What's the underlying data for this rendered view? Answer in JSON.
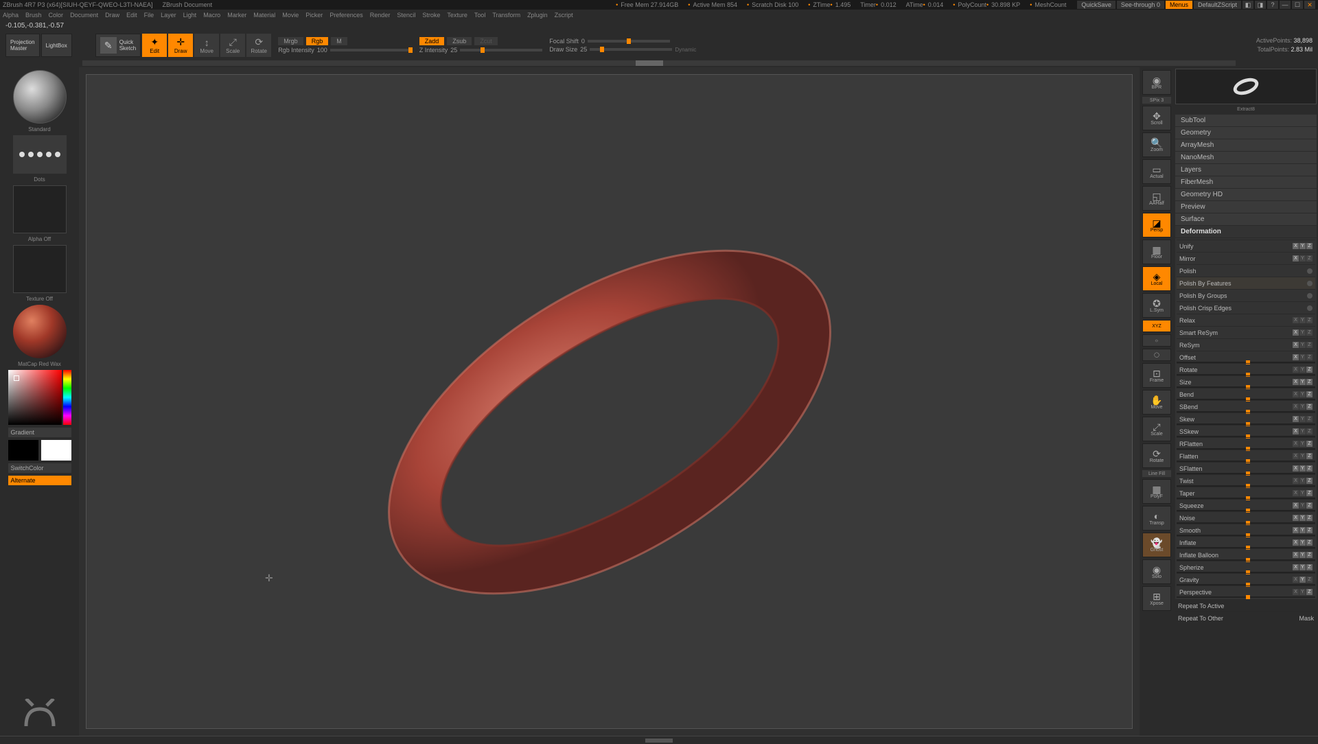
{
  "title": {
    "app": "ZBrush 4R7 P3 (x64)[SIUH-QEYF-QWEO-L3TI-NAEA]",
    "doc": "ZBrush Document",
    "free_mem_lbl": "Free Mem",
    "free_mem": "27.914GB",
    "active_mem_lbl": "Active Mem",
    "active_mem": "854",
    "scratch_lbl": "Scratch Disk",
    "scratch": "100",
    "ztime_lbl": "ZTime",
    "ztime": "1.495",
    "timer_lbl": "Timer",
    "timer": "0.012",
    "atime_lbl": "ATime",
    "atime": "0.014",
    "poly_lbl": "PolyCount",
    "poly": "30.898 KP",
    "mesh_lbl": "MeshCount",
    "quicksave": "QuickSave",
    "seethrough": "See-through  0",
    "menus": "Menus",
    "script": "DefaultZScript"
  },
  "menus": [
    "Alpha",
    "Brush",
    "Color",
    "Document",
    "Draw",
    "Edit",
    "File",
    "Layer",
    "Light",
    "Macro",
    "Marker",
    "Material",
    "Movie",
    "Picker",
    "Preferences",
    "Render",
    "Stencil",
    "Stroke",
    "Texture",
    "Tool",
    "Transform",
    "Zplugin",
    "Zscript"
  ],
  "status_coords": "-0.105,-0.381,-0.57",
  "shelf": {
    "projection": "Projection\nMaster",
    "lightbox": "LightBox",
    "quicksketch": "Quick\nSketch",
    "edit": "Edit",
    "draw": "Draw",
    "move": "Move",
    "scale": "Scale",
    "rotate": "Rotate",
    "mrgb": "Mrgb",
    "rgb": "Rgb",
    "m": "M",
    "rgb_int_lbl": "Rgb Intensity",
    "rgb_int_val": "100",
    "zadd": "Zadd",
    "zsub": "Zsub",
    "zcut": "Zcut",
    "z_int_lbl": "Z Intensity",
    "z_int_val": "25",
    "focal_lbl": "Focal Shift",
    "focal_val": "0",
    "draw_size_lbl": "Draw Size",
    "draw_size_val": "25",
    "dynamic": "Dynamic",
    "active_pts_lbl": "ActivePoints:",
    "active_pts": "38,898",
    "total_pts_lbl": "TotalPoints:",
    "total_pts": "2.83 Mil"
  },
  "left": {
    "brush_name": "Standard",
    "stroke_name": "Dots",
    "alpha_lbl": "Alpha Off",
    "texture_lbl": "Texture Off",
    "material_lbl": "MatCap Red Wax",
    "gradient": "Gradient",
    "switchcolor": "SwitchColor",
    "alternate": "Alternate"
  },
  "right_strip": {
    "bpr": "BPR",
    "spix": "SPix 3",
    "scroll": "Scroll",
    "zoom": "Zoom",
    "actual": "Actual",
    "aahalf": "AAHalf",
    "persp": "Persp",
    "floor": "Floor",
    "local": "Local",
    "lsym": "L.Sym",
    "xyz": "XYZ",
    "frame": "Frame",
    "move": "Move",
    "scale": "Scale",
    "rotate": "Rotate",
    "linefill": "Line Fill",
    "polyf": "PolyF",
    "transp": "Transp",
    "ghost": "Ghost",
    "solo": "Solo",
    "xpose": "Xpose"
  },
  "right_panel": {
    "tool_label": "Extract8",
    "sections": [
      "SubTool",
      "Geometry",
      "ArrayMesh",
      "NanoMesh",
      "Layers",
      "FiberMesh",
      "Geometry HD",
      "Preview",
      "Surface"
    ],
    "deformation_header": "Deformation",
    "deformations": [
      {
        "name": "Unify",
        "axes": "xyz"
      },
      {
        "name": "Mirror",
        "axes": "x"
      },
      {
        "name": "Polish",
        "dot": true
      },
      {
        "name": "Polish By Features",
        "dot": true,
        "hl": true
      },
      {
        "name": "Polish By Groups",
        "dot": true
      },
      {
        "name": "Polish Crisp Edges",
        "dot": true
      },
      {
        "name": "Relax",
        "axes": ""
      },
      {
        "name": "Smart ReSym",
        "axes": "x"
      },
      {
        "name": "ReSym",
        "axes": "x"
      },
      {
        "name": "Offset",
        "axes": "x",
        "slider": true
      },
      {
        "name": "Rotate",
        "axes": "z",
        "slider": true
      },
      {
        "name": "Size",
        "axes": "xyz",
        "slider": true
      },
      {
        "name": "Bend",
        "axes": "z",
        "slider": true
      },
      {
        "name": "SBend",
        "axes": "z",
        "slider": true
      },
      {
        "name": "Skew",
        "axes": "x",
        "slider": true
      },
      {
        "name": "SSkew",
        "axes": "x",
        "slider": true
      },
      {
        "name": "RFlatten",
        "axes": "z",
        "slider": true
      },
      {
        "name": "Flatten",
        "axes": "z",
        "slider": true
      },
      {
        "name": "SFlatten",
        "axes": "xyz",
        "slider": true
      },
      {
        "name": "Twist",
        "axes": "z",
        "slider": true
      },
      {
        "name": "Taper",
        "axes": "z",
        "slider": true
      },
      {
        "name": "Squeeze",
        "axes": "xz",
        "slider": true
      },
      {
        "name": "Noise",
        "axes": "xyz",
        "slider": true
      },
      {
        "name": "Smooth",
        "axes": "xyz",
        "slider": true
      },
      {
        "name": "Inflate",
        "axes": "xyz",
        "slider": true
      },
      {
        "name": "Inflate Balloon",
        "axes": "xyz",
        "slider": true
      },
      {
        "name": "Spherize",
        "axes": "xyz",
        "slider": true
      },
      {
        "name": "Gravity",
        "axes": "y",
        "slider": true
      },
      {
        "name": "Perspective",
        "axes": "z",
        "slider": true
      }
    ],
    "repeat_active": "Repeat To Active",
    "repeat_other": "Repeat To Other",
    "mask": "Mask"
  }
}
